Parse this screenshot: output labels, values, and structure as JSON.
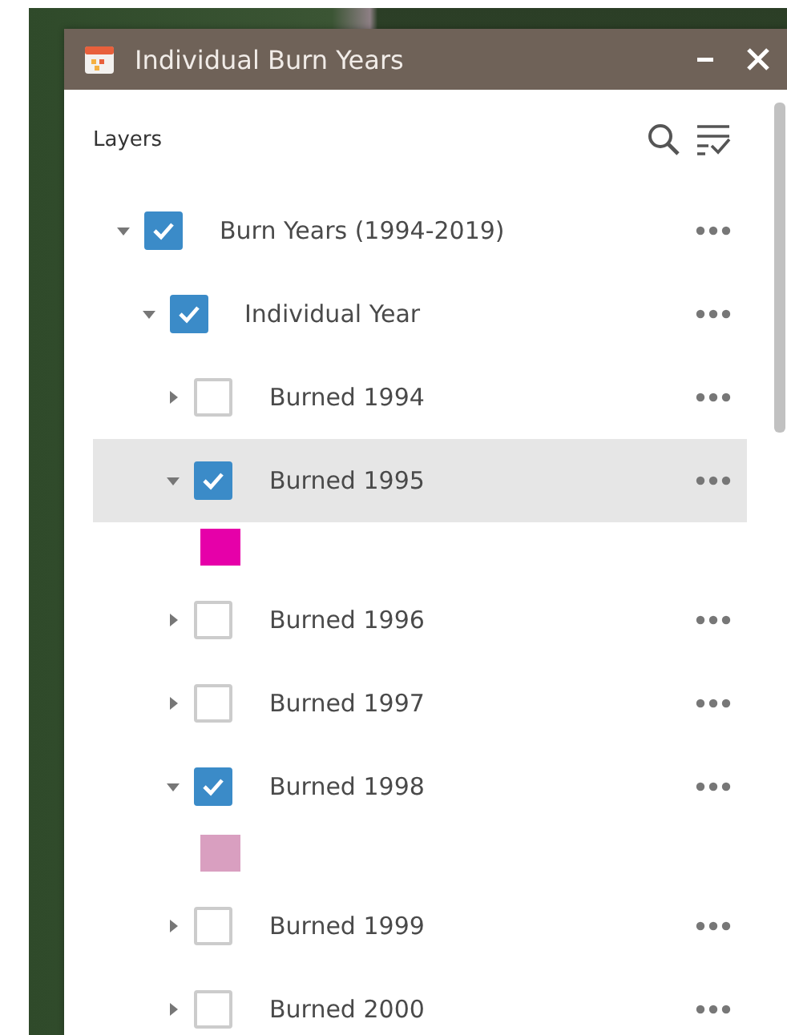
{
  "window": {
    "title": "Individual Burn Years"
  },
  "panel": {
    "heading": "Layers"
  },
  "layers": [
    {
      "label": "Burn Years (1994-2019)",
      "expanded": true,
      "checked": true,
      "selected": false,
      "children": [
        {
          "label": "Individual Year",
          "expanded": true,
          "checked": true,
          "selected": false,
          "children": [
            {
              "label": "Burned 1994",
              "expanded": false,
              "checked": false,
              "selected": false
            },
            {
              "label": "Burned 1995",
              "expanded": true,
              "checked": true,
              "selected": true,
              "color": "#e600a9"
            },
            {
              "label": "Burned 1996",
              "expanded": false,
              "checked": false,
              "selected": false
            },
            {
              "label": "Burned 1997",
              "expanded": false,
              "checked": false,
              "selected": false
            },
            {
              "label": "Burned 1998",
              "expanded": true,
              "checked": true,
              "selected": false,
              "color": "#d99fc0"
            },
            {
              "label": "Burned 1999",
              "expanded": false,
              "checked": false,
              "selected": false
            },
            {
              "label": "Burned 2000",
              "expanded": false,
              "checked": false,
              "selected": false
            }
          ]
        }
      ]
    }
  ]
}
